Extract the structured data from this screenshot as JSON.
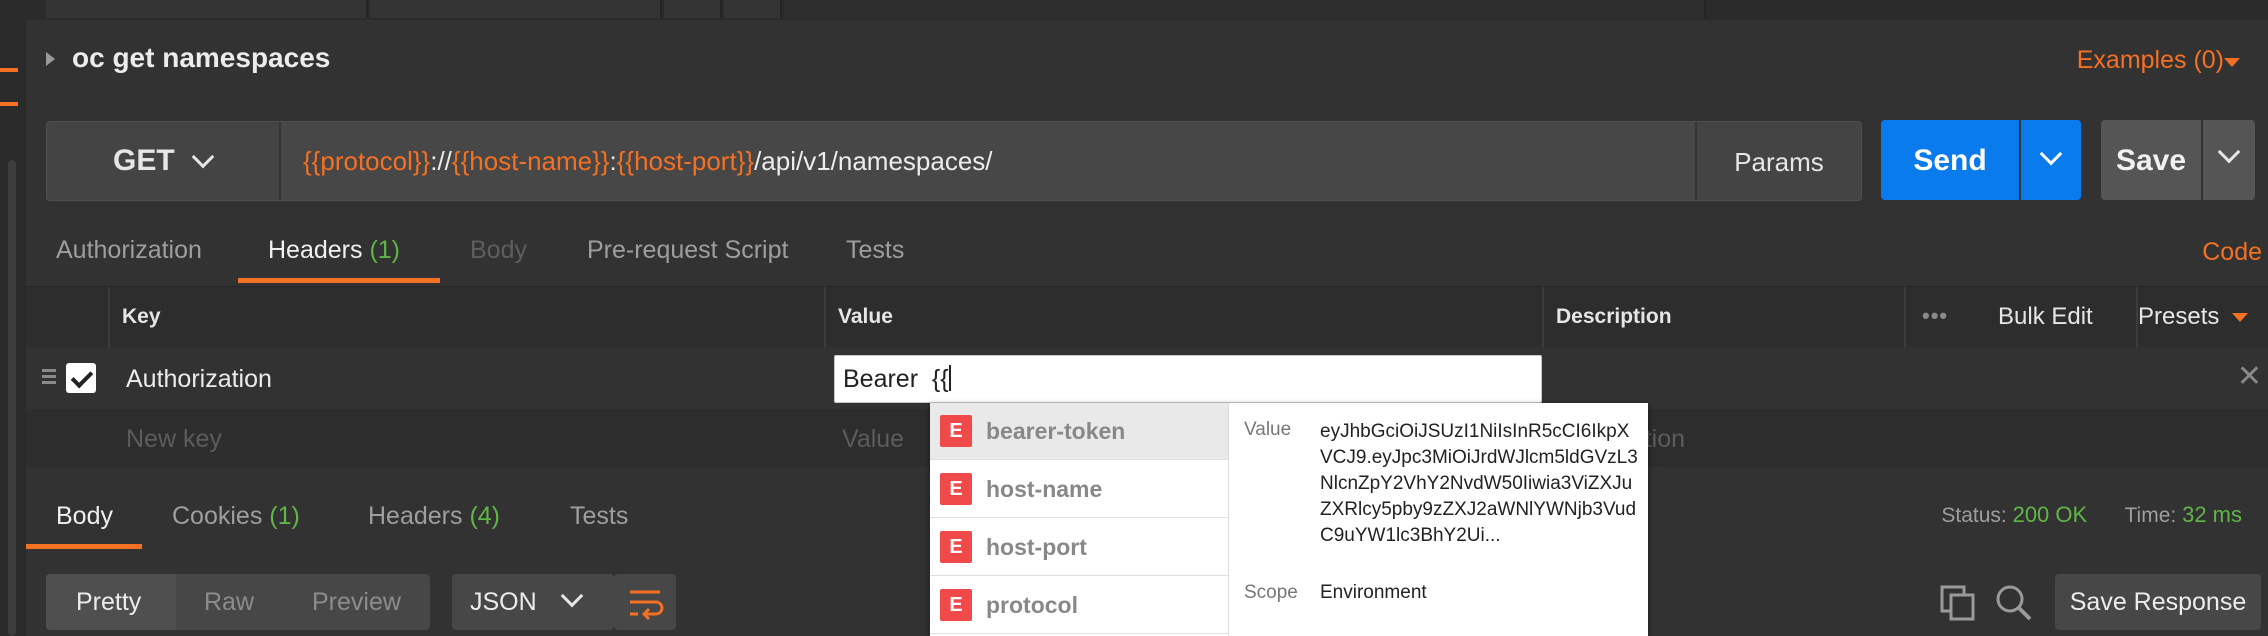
{
  "request": {
    "name": "oc get namespaces",
    "examples_label": "Examples (0)"
  },
  "url_bar": {
    "method": "GET",
    "url_parts": [
      {
        "text": "{{protocol}}",
        "var": true
      },
      {
        "text": "://",
        "var": false
      },
      {
        "text": "{{host-name}}",
        "var": true
      },
      {
        "text": ":",
        "var": false
      },
      {
        "text": "{{host-port}}",
        "var": true
      },
      {
        "text": "/api/v1/namespaces/",
        "var": false
      }
    ],
    "params_label": "Params",
    "send_label": "Send",
    "save_label": "Save"
  },
  "request_tabs": {
    "authorization": "Authorization",
    "headers": "Headers",
    "headers_count": "(1)",
    "body": "Body",
    "prerequest": "Pre-request Script",
    "tests": "Tests",
    "code": "Code"
  },
  "headers_table": {
    "columns": {
      "key": "Key",
      "value": "Value",
      "description": "Description"
    },
    "more_label": "•••",
    "bulk_edit": "Bulk Edit",
    "presets": "Presets",
    "rows": [
      {
        "key": "Authorization",
        "value": "Bearer  {{",
        "checked": true
      }
    ],
    "new_row": {
      "key_placeholder": "New key",
      "value_placeholder": "Value",
      "description_placeholder": "Description"
    }
  },
  "autocomplete": {
    "items": [
      {
        "badge": "E",
        "label": "bearer-token",
        "selected": true
      },
      {
        "badge": "E",
        "label": "host-name",
        "selected": false
      },
      {
        "badge": "E",
        "label": "host-port",
        "selected": false
      },
      {
        "badge": "E",
        "label": "protocol",
        "selected": false
      }
    ],
    "value_key": "Value",
    "value_text": "eyJhbGciOiJSUzI1NiIsInR5cCI6IkpXVCJ9.eyJpc3MiOiJrdWJlcm5ldGVzL3NlcnZpY2VhY2NvdW50Iiwia3ViZXJuZXRlcy5pby9zZXJ2aWNlYWNjb3VudC9uYW1lc3BhY2Ui...",
    "scope_key": "Scope",
    "scope_value": "Environment"
  },
  "response": {
    "tabs": {
      "body": "Body",
      "cookies": "Cookies",
      "cookies_count": "(1)",
      "headers": "Headers",
      "headers_count": "(4)",
      "tests": "Tests"
    },
    "status_label": "Status:",
    "status_value": "200 OK",
    "time_label": "Time:",
    "time_value": "32 ms",
    "format_options": [
      "Pretty",
      "Raw",
      "Preview"
    ],
    "language": "JSON",
    "save_response_label": "Save Response"
  },
  "colors": {
    "accent": "#f47023",
    "send_blue": "#097bed",
    "status_green": "#5fb547",
    "env_badge": "#ef4949"
  }
}
